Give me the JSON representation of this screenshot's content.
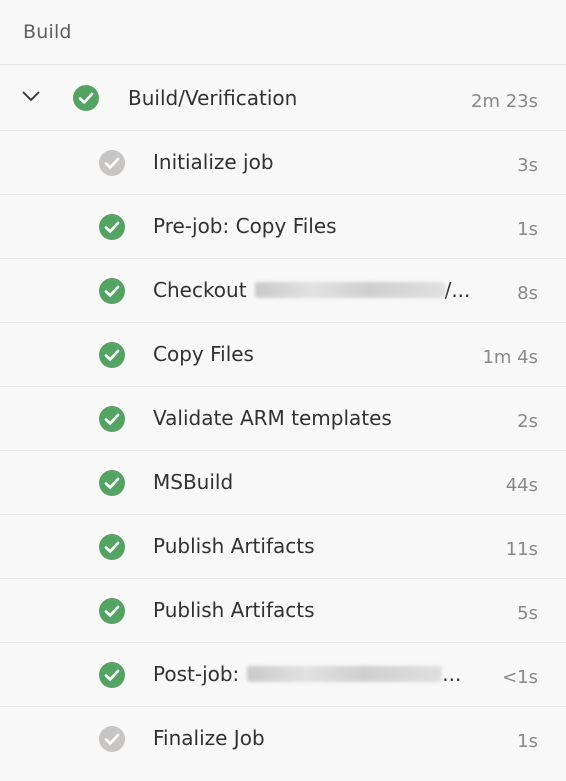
{
  "section": {
    "title": "Build"
  },
  "job": {
    "name": "Build/Verification",
    "duration": "2m 23s",
    "status": "succeeded",
    "expanded": true
  },
  "steps": [
    {
      "name": "Initialize job",
      "duration": "3s",
      "status": "skipped-gray"
    },
    {
      "name": "Pre-job: Copy Files",
      "duration": "1s",
      "status": "succeeded"
    },
    {
      "name": "Checkout",
      "suffix": "/...",
      "duration": "8s",
      "status": "succeeded",
      "redacted": true
    },
    {
      "name": "Copy Files",
      "duration": "1m 4s",
      "status": "succeeded"
    },
    {
      "name": "Validate ARM templates",
      "duration": "2s",
      "status": "succeeded"
    },
    {
      "name": "MSBuild",
      "duration": "44s",
      "status": "succeeded"
    },
    {
      "name": "Publish Artifacts",
      "duration": "11s",
      "status": "succeeded"
    },
    {
      "name": "Publish Artifacts",
      "duration": "5s",
      "status": "succeeded"
    },
    {
      "name": "Post-job:",
      "suffix": "...",
      "duration": "<1s",
      "status": "succeeded",
      "redacted": true
    },
    {
      "name": "Finalize Job",
      "duration": "1s",
      "status": "skipped-gray"
    }
  ],
  "colors": {
    "success": "#55a362",
    "neutral": "#c8c6c4",
    "text": "#323130",
    "muted": "#8a8886"
  },
  "icons": {
    "expand": "chevron-down-icon",
    "succeeded": "check-circle-icon",
    "skipped-gray": "check-circle-gray-icon"
  }
}
